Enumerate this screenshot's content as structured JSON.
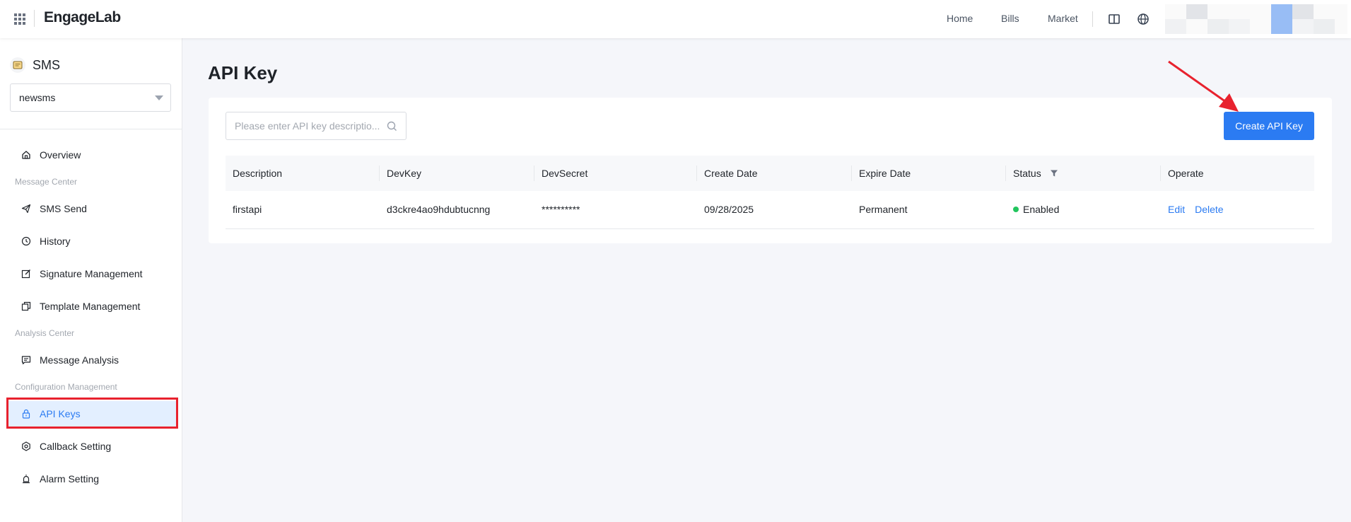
{
  "topbar": {
    "logo": "EngageLab",
    "nav": [
      "Home",
      "Bills",
      "Market"
    ],
    "icons": [
      "apps-grid-icon",
      "book-icon",
      "globe-icon"
    ]
  },
  "sidebar": {
    "app_name": "SMS",
    "app_selected": "newsms",
    "items": [
      {
        "label": "Overview",
        "icon": "home-icon"
      },
      {
        "group": "Message Center"
      },
      {
        "label": "SMS Send",
        "icon": "send-icon"
      },
      {
        "label": "History",
        "icon": "history-icon"
      },
      {
        "label": "Signature Management",
        "icon": "edit-icon"
      },
      {
        "label": "Template Management",
        "icon": "copy-icon"
      },
      {
        "group": "Analysis Center"
      },
      {
        "label": "Message Analysis",
        "icon": "message-icon"
      },
      {
        "group": "Configuration Management"
      },
      {
        "label": "API Keys",
        "icon": "lock-icon",
        "active": true
      },
      {
        "label": "Callback Setting",
        "icon": "settings-icon"
      },
      {
        "label": "Alarm Setting",
        "icon": "alarm-icon"
      }
    ]
  },
  "main": {
    "title": "API Key",
    "search_placeholder": "Please enter API key descriptio...",
    "create_button": "Create API Key",
    "table": {
      "columns": [
        "Description",
        "DevKey",
        "DevSecret",
        "Create Date",
        "Expire Date",
        "Status",
        "Operate"
      ],
      "rows": [
        {
          "description": "firstapi",
          "devkey": "d3ckre4ao9hdubtucnng",
          "devsecret": "**********",
          "create_date": "09/28/2025",
          "expire_date": "Permanent",
          "status": "Enabled",
          "actions": [
            "Edit",
            "Delete"
          ]
        }
      ]
    }
  },
  "colors": {
    "accent": "#2b7bf2",
    "status_enabled": "#22c55e",
    "annotation": "#e8222e"
  }
}
